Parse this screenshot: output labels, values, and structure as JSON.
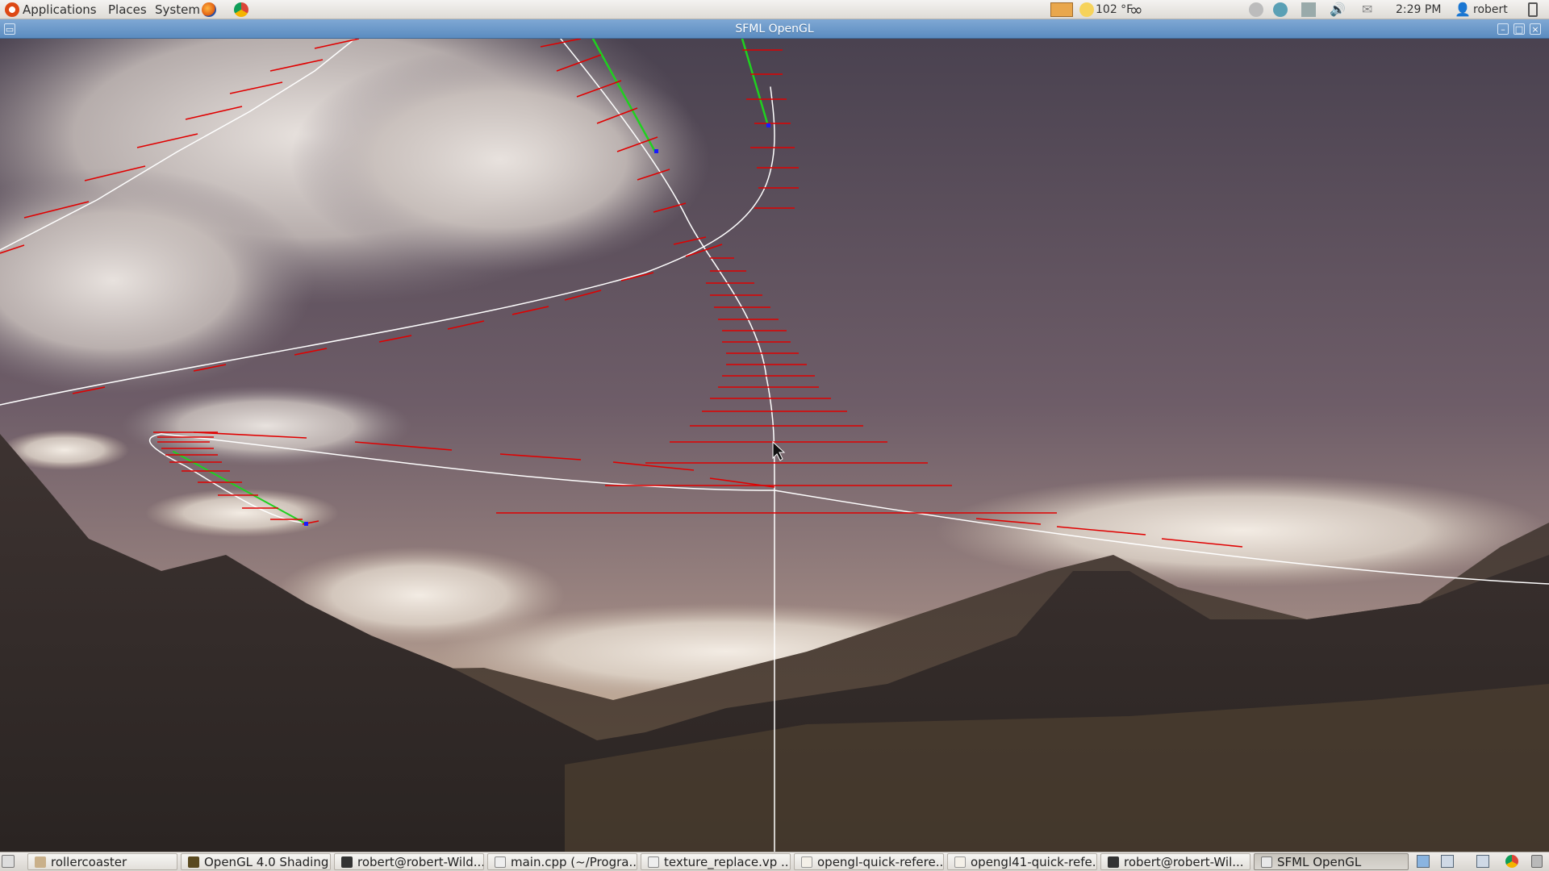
{
  "top_panel": {
    "menus": [
      "Applications",
      "Places",
      "System"
    ],
    "weather": "102 °F",
    "clock": "2:29 PM",
    "user": "robert"
  },
  "window": {
    "title": "SFML OpenGL"
  },
  "taskbar": {
    "items": [
      {
        "label": "rollercoaster",
        "icon": "folder-icon"
      },
      {
        "label": "OpenGL 4.0 Shading...",
        "icon": "document-viewer-icon"
      },
      {
        "label": "robert@robert-Wild...",
        "icon": "terminal-icon"
      },
      {
        "label": "main.cpp (~/Progra...",
        "icon": "text-editor-icon"
      },
      {
        "label": "texture_replace.vp ...",
        "icon": "text-editor-icon"
      },
      {
        "label": "opengl-quick-refere...",
        "icon": "pdf-icon"
      },
      {
        "label": "opengl41-quick-refe...",
        "icon": "pdf-icon"
      },
      {
        "label": "robert@robert-Wil...",
        "icon": "terminal-icon"
      },
      {
        "label": "SFML OpenGL",
        "icon": "window-icon"
      }
    ]
  },
  "colors": {
    "track_rail": "#ffffff",
    "track_ties": "#ff0000",
    "track_highlight": "#00cc00",
    "titlebar": "#6a99c9"
  }
}
